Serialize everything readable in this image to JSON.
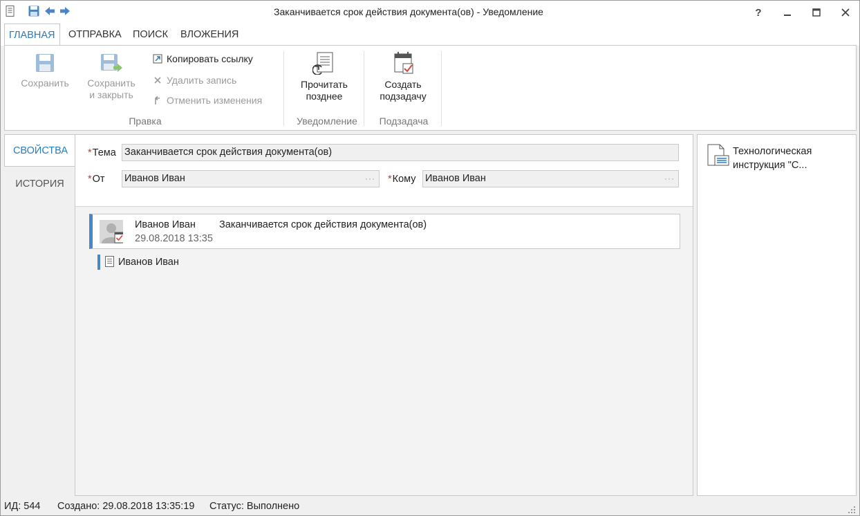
{
  "window": {
    "title": "Заканчивается срок действия документа(ов) - Уведомление",
    "help": "?",
    "minimize": "—",
    "maximize": "☐",
    "close": "✕"
  },
  "tabs": [
    {
      "label": "ГЛАВНАЯ",
      "active": true
    },
    {
      "label": "ОТПРАВКА"
    },
    {
      "label": "ПОИСК"
    },
    {
      "label": "ВЛОЖЕНИЯ"
    }
  ],
  "ribbon": {
    "edit_group": {
      "label": "Правка",
      "save": "Сохранить",
      "save_close_1": "Сохранить",
      "save_close_2": "и закрыть",
      "copy_link": "Копировать ссылку",
      "delete": "Удалить запись",
      "undo": "Отменить изменения"
    },
    "notify_group": {
      "label": "Уведомление",
      "read_later_1": "Прочитать",
      "read_later_2": "позднее"
    },
    "subtask_group": {
      "label": "Подзадача",
      "create_1": "Создать",
      "create_2": "подзадачу"
    }
  },
  "nav": [
    {
      "label": "СВОЙСТВА",
      "active": true
    },
    {
      "label": "ИСТОРИЯ"
    }
  ],
  "props": {
    "subject_label": "Тема",
    "subject_value": "Заканчивается срок действия документа(ов)",
    "from_label": "От",
    "from_value": "Иванов Иван",
    "to_label": "Кому",
    "to_value": "Иванов Иван",
    "dots": "···"
  },
  "message": {
    "author": "Иванов Иван",
    "subject": "Заканчивается срок действия документа(ов)",
    "date": "29.08.2018 13:35"
  },
  "recipient": {
    "name": "Иванов Иван"
  },
  "attachment": {
    "name": "Технологическая инструкция \"С..."
  },
  "status": {
    "id": "ИД: 544",
    "created": "Создано: 29.08.2018 13:35:19",
    "state": "Статус: Выполнено"
  }
}
